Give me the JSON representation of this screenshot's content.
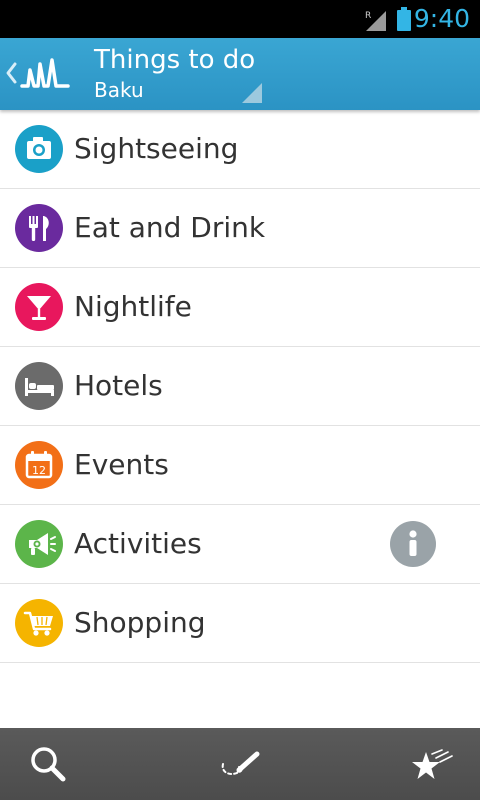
{
  "status_bar": {
    "time": "9:40",
    "network_indicator": "R",
    "icons": [
      "signal-icon",
      "battery-icon"
    ],
    "accent_color": "#33b5e5"
  },
  "action_bar": {
    "title": "Things to do",
    "subtitle": "Baku",
    "icons": [
      "back-chevron-icon",
      "app-logo-icon"
    ],
    "color": "#2f9bcb"
  },
  "categories": [
    {
      "label": "Sightseeing",
      "icon": "camera-icon",
      "color": "#1aa0c8"
    },
    {
      "label": "Eat and Drink",
      "icon": "fork-knife-icon",
      "color": "#6a2a9e"
    },
    {
      "label": "Nightlife",
      "icon": "cocktail-icon",
      "color": "#e8175d"
    },
    {
      "label": "Hotels",
      "icon": "bed-icon",
      "color": "#6b6b6b"
    },
    {
      "label": "Events",
      "icon": "calendar-icon",
      "color": "#f26f17",
      "icon_text": "12"
    },
    {
      "label": "Activities",
      "icon": "megaphone-icon",
      "color": "#5cb54a",
      "has_info": true
    },
    {
      "label": "Shopping",
      "icon": "cart-icon",
      "color": "#f5b400"
    }
  ],
  "bottom_bar": {
    "icons": [
      "search-icon",
      "route-pencil-icon",
      "favorites-stars-icon"
    ]
  }
}
